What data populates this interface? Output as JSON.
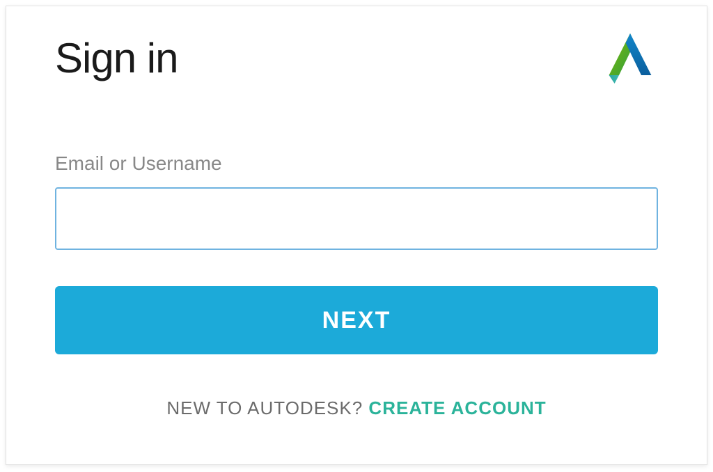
{
  "title": "Sign in",
  "logo_name": "autodesk-logo-icon",
  "field": {
    "label": "Email or Username",
    "value": "",
    "placeholder": ""
  },
  "button": {
    "next_label": "NEXT"
  },
  "footer": {
    "prompt": "NEW TO AUTODESK? ",
    "link": "CREATE ACCOUNT"
  },
  "colors": {
    "accent": "#1caad9",
    "link": "#2bb39a",
    "border_focus": "#6fb3e0"
  }
}
